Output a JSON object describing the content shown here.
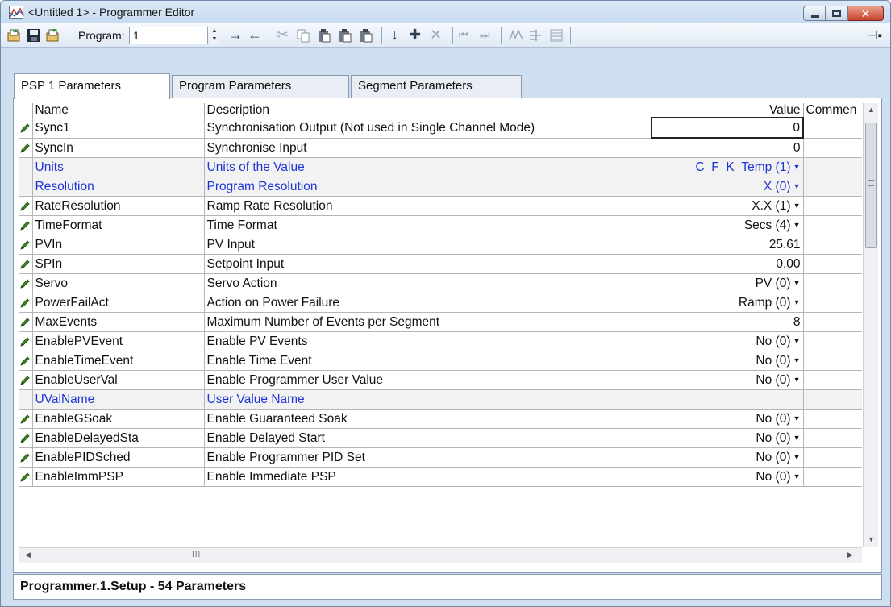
{
  "window": {
    "title": "<Untitled 1> - Programmer Editor",
    "close_symbol": "✕"
  },
  "toolbar": {
    "program_label": "Program:",
    "program_value": "1",
    "icons": [
      "open-icon",
      "save-icon",
      "save-as-icon",
      "spin-up-down",
      "arrow-right-icon",
      "arrow-left-icon",
      "cut-icon",
      "copy-icon",
      "paste-icon",
      "paste-special-icon",
      "paste-all-icon",
      "move-down-icon",
      "insert-icon",
      "delete-icon",
      "first-icon",
      "last-icon",
      "chart-icon",
      "segments-icon",
      "table-icon",
      "pin-icon"
    ]
  },
  "tabs": [
    {
      "label": "PSP 1 Parameters",
      "active": true
    },
    {
      "label": "Program Parameters",
      "active": false
    },
    {
      "label": "Segment Parameters",
      "active": false
    }
  ],
  "table": {
    "headers": {
      "name": "Name",
      "description": "Description",
      "value": "Value",
      "comment": "Commen"
    },
    "rows": [
      {
        "name": "Sync1",
        "description": "Synchronisation Output (Not used in Single Channel Mode)",
        "value": "0",
        "editable": true,
        "dropdown": false,
        "style": "normal",
        "selected": true
      },
      {
        "name": "SyncIn",
        "description": "Synchronise Input",
        "value": "0",
        "editable": true,
        "dropdown": false,
        "style": "normal"
      },
      {
        "name": "Units",
        "description": "Units of the Value",
        "value": "C_F_K_Temp (1)",
        "editable": false,
        "dropdown": true,
        "style": "blue"
      },
      {
        "name": "Resolution",
        "description": "Program Resolution",
        "value": "X (0)",
        "editable": false,
        "dropdown": true,
        "style": "blue"
      },
      {
        "name": "RateResolution",
        "description": "Ramp Rate Resolution",
        "value": "X.X (1)",
        "editable": true,
        "dropdown": true,
        "style": "normal"
      },
      {
        "name": "TimeFormat",
        "description": "Time Format",
        "value": "Secs (4)",
        "editable": true,
        "dropdown": true,
        "style": "normal"
      },
      {
        "name": "PVIn",
        "description": "PV Input",
        "value": "25.61",
        "editable": true,
        "dropdown": false,
        "style": "normal"
      },
      {
        "name": "SPIn",
        "description": "Setpoint Input",
        "value": "0.00",
        "editable": true,
        "dropdown": false,
        "style": "normal"
      },
      {
        "name": "Servo",
        "description": "Servo Action",
        "value": "PV (0)",
        "editable": true,
        "dropdown": true,
        "style": "normal"
      },
      {
        "name": "PowerFailAct",
        "description": "Action on Power Failure",
        "value": "Ramp (0)",
        "editable": true,
        "dropdown": true,
        "style": "normal"
      },
      {
        "name": "MaxEvents",
        "description": "Maximum Number of Events per Segment",
        "value": "8",
        "editable": true,
        "dropdown": false,
        "style": "normal"
      },
      {
        "name": "EnablePVEvent",
        "description": "Enable PV Events",
        "value": "No (0)",
        "editable": true,
        "dropdown": true,
        "style": "normal"
      },
      {
        "name": "EnableTimeEvent",
        "description": "Enable Time Event",
        "value": "No (0)",
        "editable": true,
        "dropdown": true,
        "style": "normal"
      },
      {
        "name": "EnableUserVal",
        "description": "Enable Programmer User Value",
        "value": "No (0)",
        "editable": true,
        "dropdown": true,
        "style": "normal"
      },
      {
        "name": "UValName",
        "description": "User Value Name",
        "value": "",
        "editable": false,
        "dropdown": false,
        "style": "blue"
      },
      {
        "name": "EnableGSoak",
        "description": "Enable Guaranteed Soak",
        "value": "No (0)",
        "editable": true,
        "dropdown": true,
        "style": "normal"
      },
      {
        "name": "EnableDelayedSta",
        "description": "Enable Delayed Start",
        "value": "No (0)",
        "editable": true,
        "dropdown": true,
        "style": "normal"
      },
      {
        "name": "EnablePIDSched",
        "description": "Enable Programmer PID Set",
        "value": "No (0)",
        "editable": true,
        "dropdown": true,
        "style": "normal"
      },
      {
        "name": "EnableImmPSP",
        "description": "Enable Immediate PSP",
        "value": "No (0)",
        "editable": true,
        "dropdown": true,
        "style": "normal"
      }
    ]
  },
  "scrollbar": {
    "grip": "III",
    "up": "▲",
    "down": "▼",
    "left": "◀",
    "right": "▶"
  },
  "status": {
    "text": "Programmer.1.Setup  -  54 Parameters"
  },
  "colors": {
    "blue_row_text": "#1f35d8",
    "pencil": "#3a8a1e",
    "close_button": "#c7432b"
  }
}
